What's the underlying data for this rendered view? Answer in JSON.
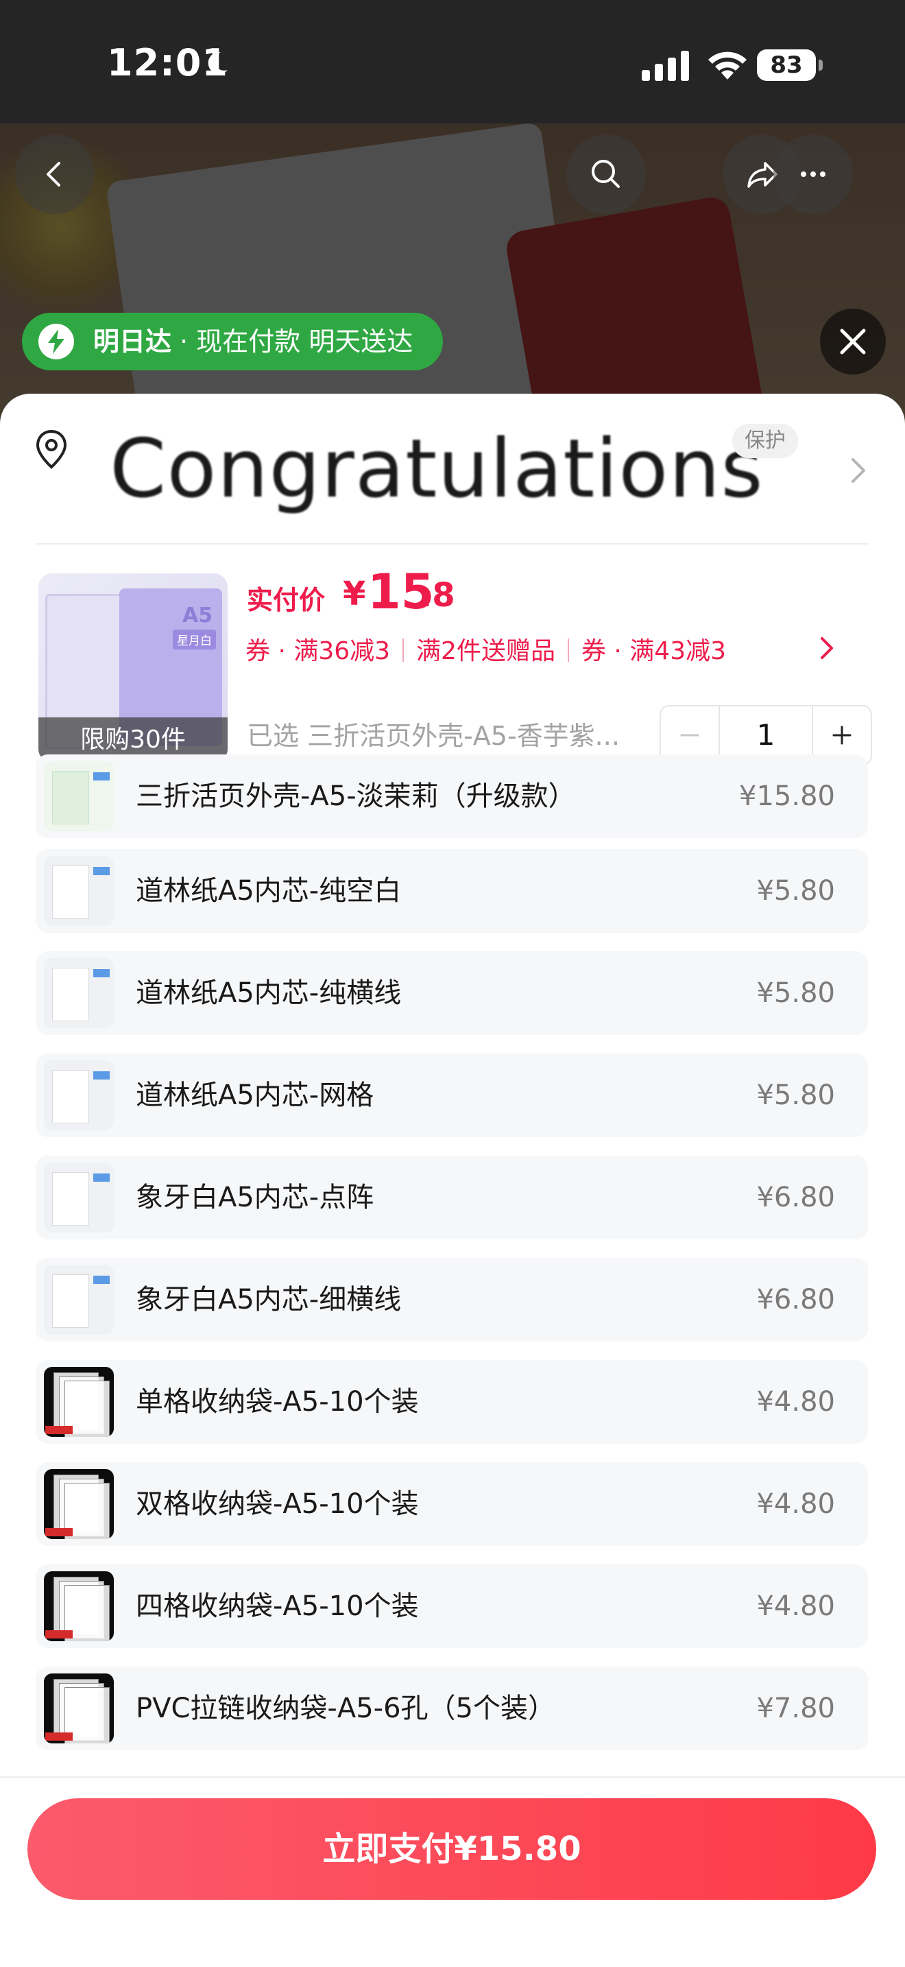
{
  "status_bar": {
    "time": "12:01",
    "battery": "83"
  },
  "delivery_badge": {
    "brand": "明日达",
    "text": " · 现在付款 明天送达"
  },
  "sheet": {
    "headline": "Congratulations",
    "guard_tag": "保护",
    "product": {
      "limit_label": "限购30件",
      "thumb_a5": "A5",
      "thumb_badge": "星月白",
      "price_label": "实付价",
      "price_symbol": "¥",
      "price_integer": "15",
      "price_decimal": ".8",
      "promos": [
        "券 · 满36减3",
        "满2件送赠品",
        "券 · 满43减3"
      ],
      "selected": "已选 三折活页外壳-A5-香芋紫...",
      "quantity": "1"
    },
    "options": [
      {
        "name": "三折活页外壳-A5-淡茉莉（升级款）",
        "price": "¥15.80",
        "thumb": "green"
      },
      {
        "name": "道林纸A5内芯-纯空白",
        "price": "¥5.80",
        "thumb": "paper"
      },
      {
        "name": "道林纸A5内芯-纯横线",
        "price": "¥5.80",
        "thumb": "paper"
      },
      {
        "name": "道林纸A5内芯-网格",
        "price": "¥5.80",
        "thumb": "paper"
      },
      {
        "name": "象牙白A5内芯-点阵",
        "price": "¥6.80",
        "thumb": "paper"
      },
      {
        "name": "象牙白A5内芯-细横线",
        "price": "¥6.80",
        "thumb": "paper"
      },
      {
        "name": "单格收纳袋-A5-10个装",
        "price": "¥4.80",
        "thumb": "dark"
      },
      {
        "name": "双格收纳袋-A5-10个装",
        "price": "¥4.80",
        "thumb": "dark"
      },
      {
        "name": "四格收纳袋-A5-10个装",
        "price": "¥4.80",
        "thumb": "dark"
      },
      {
        "name": "PVC拉链收纳袋-A5-6孔（5个装）",
        "price": "¥7.80",
        "thumb": "dark"
      }
    ],
    "pay_button": "立即支付¥15.80"
  },
  "colors": {
    "accent": "#ee1c4b",
    "delivery_green": "#2fa843",
    "pay_start": "#fb5b6c",
    "pay_end": "#fe3a47"
  }
}
